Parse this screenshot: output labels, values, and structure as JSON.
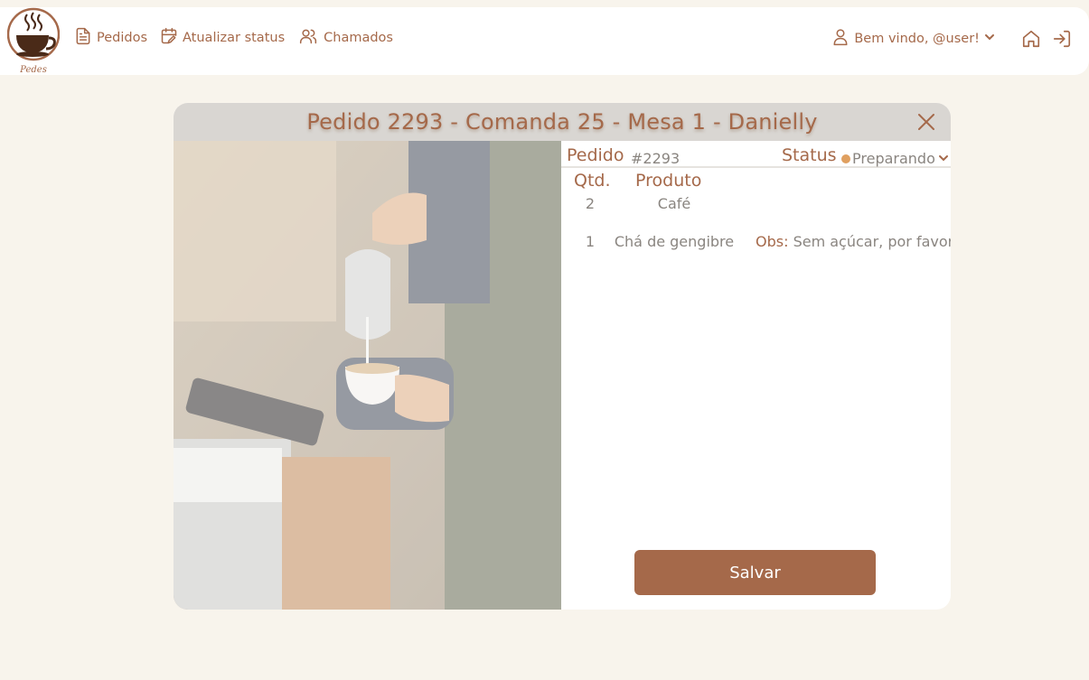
{
  "brand": {
    "logo_text": "Pedes"
  },
  "nav": {
    "links": [
      {
        "label": "Pedidos",
        "icon": "document-icon"
      },
      {
        "label": "Atualizar status",
        "icon": "calendar-edit-icon"
      },
      {
        "label": "Chamados",
        "icon": "users-icon"
      }
    ],
    "user_greeting": "Bem vindo, @user!"
  },
  "modal": {
    "title": "Pedido 2293 - Comanda 25 - Mesa 1 - Danielly",
    "order_label": "Pedido",
    "order_value": "#2293",
    "status_label": "Status",
    "status_value": "Preparando",
    "status_color": "#e0a060",
    "columns": {
      "qty": "Qtd.",
      "product": "Produto"
    },
    "items": [
      {
        "qty": "2",
        "product": "Café",
        "obs_label": "",
        "obs": ""
      },
      {
        "qty": "1",
        "product": "Chá de gengibre",
        "obs_label": "Obs:",
        "obs": "Sem açúcar, por favor."
      }
    ],
    "save_label": "Salvar"
  },
  "colors": {
    "accent": "#a5694a",
    "background": "#f8f4ec",
    "header_bg": "#d9d6d2"
  }
}
